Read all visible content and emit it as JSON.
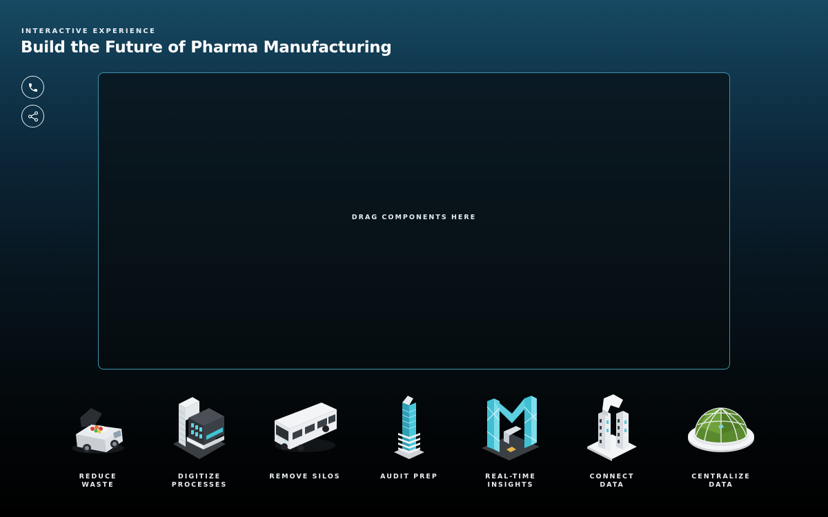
{
  "header": {
    "eyebrow": "INTERACTIVE EXPERIENCE",
    "title": "Build the Future of Pharma Manufacturing"
  },
  "sidebar": {
    "buttons": [
      {
        "icon": "phone-icon"
      },
      {
        "icon": "share-icon"
      }
    ]
  },
  "dropzone": {
    "label": "DRAG COMPONENTS HERE"
  },
  "components": [
    {
      "label": "REDUCE\nWASTE",
      "icon": "delivery-van-icon"
    },
    {
      "label": "DIGITIZE\nPROCESSES",
      "icon": "digital-building-icon"
    },
    {
      "label": "REMOVE SILOS",
      "icon": "bus-icon"
    },
    {
      "label": "AUDIT PREP",
      "icon": "tower-icon"
    },
    {
      "label": "REAL-TIME\nINSIGHTS",
      "icon": "m-structure-icon"
    },
    {
      "label": "CONNECT\nDATA",
      "icon": "twin-towers-icon"
    },
    {
      "label": "CENTRALIZE\nDATA",
      "icon": "dome-icon"
    }
  ],
  "colors": {
    "accent": "#3f93ac",
    "teal": "#3fc4d6",
    "background_top": "#174a63",
    "background_bottom": "#000000"
  }
}
